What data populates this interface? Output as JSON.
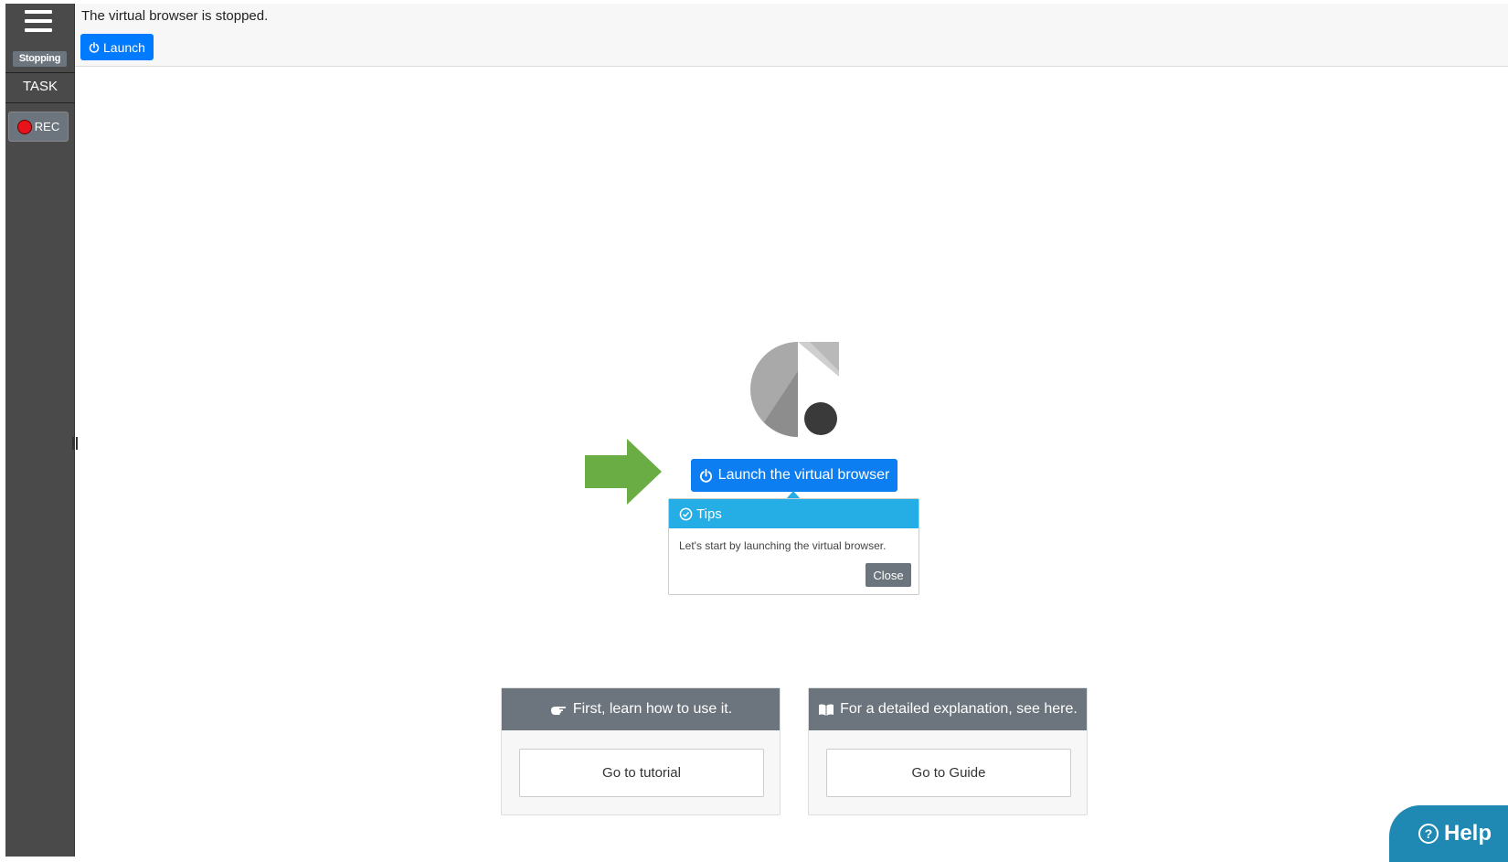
{
  "sidebar": {
    "status_badge": "Stopping",
    "task_label": "TASK",
    "rec_label": "REC"
  },
  "topbar": {
    "status_text": "The virtual browser is stopped.",
    "launch_label": "Launch"
  },
  "main": {
    "launch_button_label": "Launch the virtual browser",
    "tips": {
      "title": "Tips",
      "message": "Let's start by launching the virtual browser.",
      "close_label": "Close"
    },
    "cards": [
      {
        "header": "First, learn how to use it.",
        "button": "Go to tutorial"
      },
      {
        "header": "For a detailed explanation, see here.",
        "button": "Go to Guide"
      }
    ]
  },
  "help": {
    "label": "Help"
  },
  "colors": {
    "sidebar_bg": "#4a4a4a",
    "primary_blue": "#007bff",
    "tips_header": "#25aee6",
    "card_header": "#6c757d",
    "arrow_green": "#6aad45",
    "help_bg": "#1f89b4",
    "rec_red": "#e8121b"
  }
}
